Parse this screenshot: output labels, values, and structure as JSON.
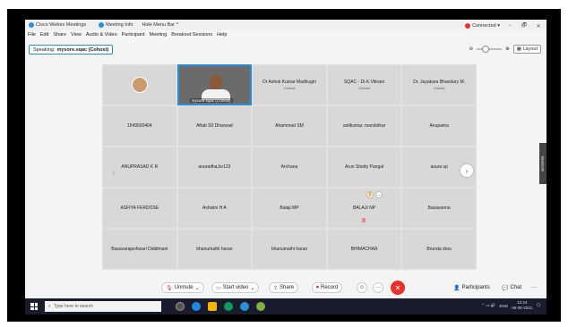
{
  "window": {
    "app_title": "Cisco Webex Meetings",
    "meeting_info": "Meeting Info",
    "hide_menu_bar": "Hide Menu Bar ^",
    "status": "Connected ▾",
    "min": "−",
    "max": "🗗",
    "close": "✕"
  },
  "menu": [
    "File",
    "Edit",
    "Share",
    "View",
    "Audio & Video",
    "Participant",
    "Meeting",
    "Breakout Sessions",
    "Help"
  ],
  "speaking": {
    "label": "Speaking:",
    "name": "mysore.sqac (Cohost)"
  },
  "layout_label": "Layout",
  "side_tab": "Bluetooth",
  "participants": [
    {
      "name": "",
      "sub": "",
      "kind": "avatar"
    },
    {
      "name": "mysore.sqac (Cohost)",
      "sub": "",
      "kind": "video"
    },
    {
      "name": "Dr Ashok Kumar Madhugiri",
      "sub": "Cohost",
      "kind": "plain"
    },
    {
      "name": "SQAC - Dr.K.Vikram",
      "sub": "Cohost",
      "kind": "plain"
    },
    {
      "name": "Dr. Jayakara Bhandary M.",
      "sub": "Cohost",
      "kind": "plain"
    },
    {
      "name": "1549500404",
      "sub": "",
      "kind": "plain"
    },
    {
      "name": "Aftab S0 Dharwad",
      "sub": "",
      "kind": "plain"
    },
    {
      "name": "Ahammad SM",
      "sub": "",
      "kind": "plain"
    },
    {
      "name": "anilkumar. mandolkar",
      "sub": "",
      "kind": "plain"
    },
    {
      "name": "Anupama",
      "sub": "",
      "kind": "plain"
    },
    {
      "name": "ANUPRASAD K R",
      "sub": "",
      "kind": "plain"
    },
    {
      "name": "anuradhaJsr123",
      "sub": "",
      "kind": "plain"
    },
    {
      "name": "Archana",
      "sub": "",
      "kind": "plain"
    },
    {
      "name": "Arun Shetty Pangal",
      "sub": "",
      "kind": "plain"
    },
    {
      "name": "asura sp",
      "sub": "",
      "kind": "plain"
    },
    {
      "name": "ASFIYA FERDOSE",
      "sub": "",
      "kind": "plain"
    },
    {
      "name": "Ashwini H A",
      "sub": "",
      "kind": "plain"
    },
    {
      "name": "Balaji MP",
      "sub": "",
      "kind": "plain"
    },
    {
      "name": "BALAJI NP",
      "sub": "",
      "kind": "hover"
    },
    {
      "name": "Basavanna",
      "sub": "",
      "kind": "plain"
    },
    {
      "name": "Basavarajeshwari Diddimani",
      "sub": "",
      "kind": "plain"
    },
    {
      "name": "bhanumathi haran",
      "sub": "",
      "kind": "plain"
    },
    {
      "name": "bhanumathi haran",
      "sub": "",
      "kind": "plain"
    },
    {
      "name": "BHIMACHAR",
      "sub": "",
      "kind": "plain"
    },
    {
      "name": "Brunda doru",
      "sub": "",
      "kind": "plain"
    }
  ],
  "toolbar": {
    "unmute": "Unmute",
    "start_video": "Start video",
    "share": "Share",
    "record": "Record",
    "participants": "Participants",
    "chat": "Chat",
    "more": "···",
    "end": "✕"
  },
  "taskbar": {
    "search_placeholder": "Type here to search",
    "lang": "ENG",
    "time": "12:24",
    "date": "05-06-2021"
  },
  "colors": {
    "accent": "#2a8fd6",
    "end": "#e5322d",
    "tile": "#d8d8d8"
  }
}
